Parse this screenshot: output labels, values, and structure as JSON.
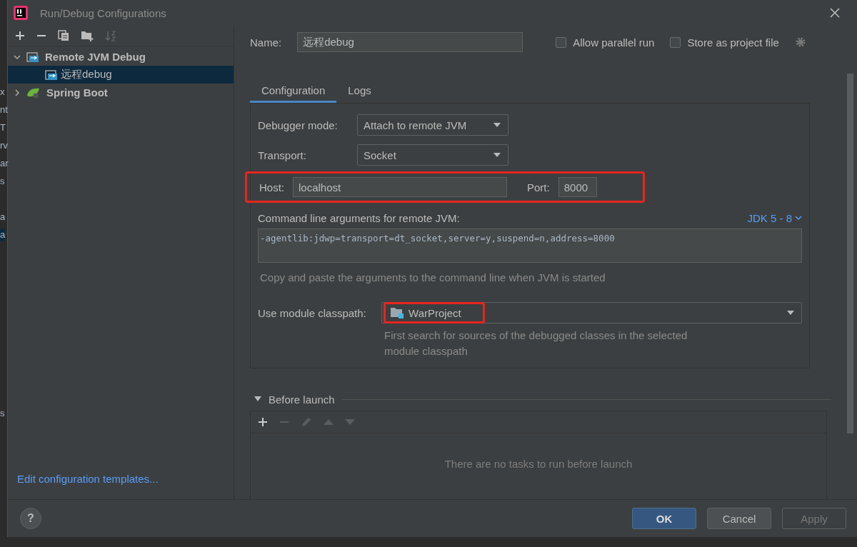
{
  "background_fragments": [
    {
      "text": "x",
      "selected": false
    },
    {
      "text": "nt",
      "selected": false
    },
    {
      "text": "T",
      "selected": false
    },
    {
      "text": "rv",
      "selected": false
    },
    {
      "text": "ar",
      "selected": false
    },
    {
      "text": "s",
      "selected": false
    },
    {
      "text": "a",
      "selected": false
    },
    {
      "text": "a",
      "selected": true
    },
    {
      "text": "s",
      "selected": false
    }
  ],
  "window": {
    "title": "Run/Debug Configurations"
  },
  "tree": [
    {
      "label": "Remote JVM Debug",
      "kind": "remote",
      "expanded": true,
      "selected": false,
      "children": [
        {
          "label": "远程debug",
          "kind": "remote",
          "selected": true
        }
      ]
    },
    {
      "label": "Spring Boot",
      "kind": "spring",
      "expanded": false,
      "selected": false
    }
  ],
  "edit_templates_link": "Edit configuration templates...",
  "name": {
    "label": "Name:",
    "value": "远程debug"
  },
  "options": [
    {
      "label": "Allow parallel run",
      "checked": false
    },
    {
      "label": "Store as project file",
      "checked": false
    }
  ],
  "tabs": [
    {
      "label": "Configuration",
      "selected": true
    },
    {
      "label": "Logs",
      "selected": false
    }
  ],
  "debugger_mode": {
    "label": "Debugger mode:",
    "value": "Attach to remote JVM"
  },
  "transport": {
    "label": "Transport:",
    "value": "Socket"
  },
  "host_port": {
    "highlighted": true,
    "host_label": "Host:",
    "host": "localhost",
    "port_label": "Port:",
    "port": "8000"
  },
  "command_line": {
    "label": "Command line arguments for remote JVM:",
    "jdk": "JDK 5 - 8",
    "value": "-agentlib:jdwp=transport=dt_socket,server=y,suspend=n,address=8000",
    "hint": "Copy and paste the arguments to the command line when JVM is started"
  },
  "module_classpath": {
    "label": "Use module classpath:",
    "value": "WarProject",
    "highlighted": true,
    "hint": "First search for sources of the debugged classes in the selected module classpath"
  },
  "before_launch": {
    "title": "Before launch",
    "expanded": true,
    "empty_text": "There are no tasks to run before launch"
  },
  "help_button": "?",
  "buttons": [
    {
      "label": "OK",
      "kind": "primary"
    },
    {
      "label": "Cancel",
      "kind": "normal"
    },
    {
      "label": "Apply",
      "kind": "disabled"
    }
  ]
}
